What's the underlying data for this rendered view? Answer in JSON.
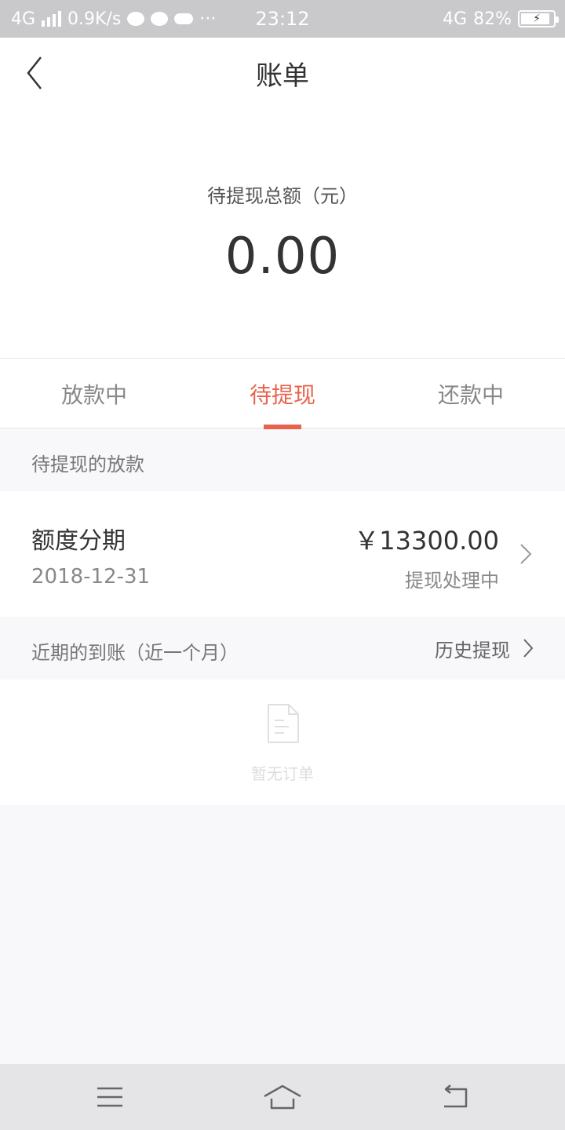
{
  "status_bar": {
    "network_left": "4G",
    "speed": "0.9K/s",
    "more": "···",
    "time": "23:12",
    "network_right": "4G",
    "battery": "82%"
  },
  "header": {
    "title": "账单"
  },
  "summary": {
    "label": "待提现总额（元）",
    "amount": "0.00"
  },
  "tabs": [
    {
      "label": "放款中",
      "active": false
    },
    {
      "label": "待提现",
      "active": true
    },
    {
      "label": "还款中",
      "active": false
    }
  ],
  "pending_section": {
    "label": "待提现的放款"
  },
  "loan": {
    "title": "额度分期",
    "date": "2018-12-31",
    "amount": "￥13300.00",
    "status": "提现处理中"
  },
  "recent_section": {
    "label": "近期的到账（近一个月）",
    "history_link": "历史提现"
  },
  "empty_state": {
    "text": "暂无订单"
  },
  "colors": {
    "accent": "#e8634d",
    "status_bar": "#c9c8cb",
    "background": "#f8f7fa"
  }
}
